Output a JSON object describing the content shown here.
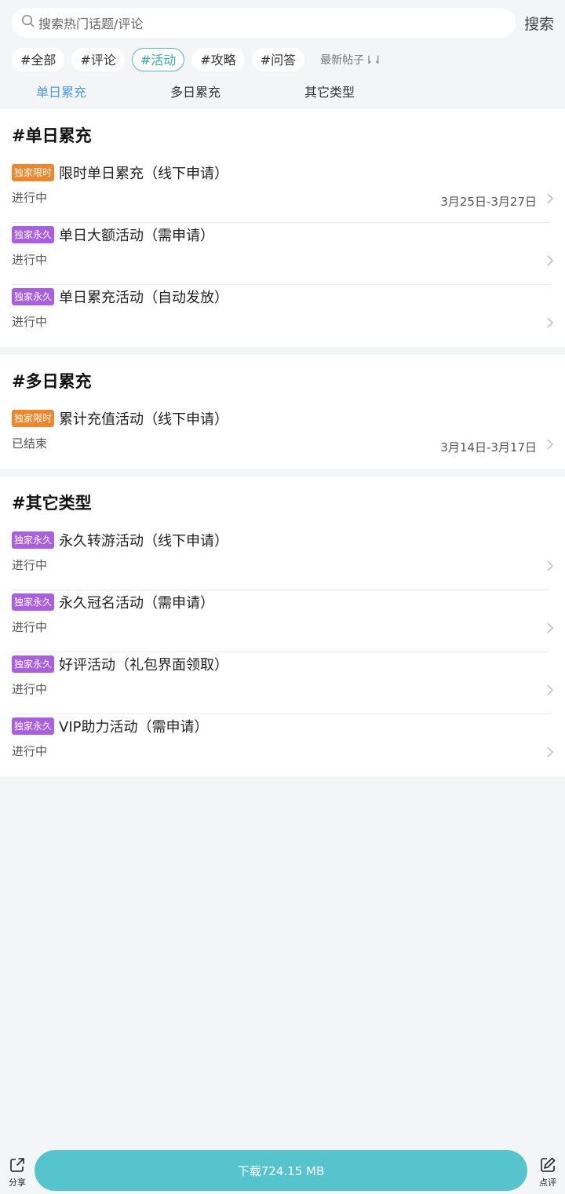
{
  "search": {
    "placeholder": "搜索热门话题/评论",
    "button": "搜索"
  },
  "tags": [
    {
      "label": "#全部",
      "active": false
    },
    {
      "label": "#评论",
      "active": false
    },
    {
      "label": "#活动",
      "active": true
    },
    {
      "label": "#攻略",
      "active": false
    },
    {
      "label": "#问答",
      "active": false
    }
  ],
  "sort_label": "最新帖子⇂⇃",
  "subtabs": [
    {
      "label": "单日累充",
      "active": true
    },
    {
      "label": "多日累充",
      "active": false
    },
    {
      "label": "其它类型",
      "active": false
    }
  ],
  "sections": [
    {
      "title": "#单日累充",
      "items": [
        {
          "badge": "独家限时",
          "badge_color": "#f0862b",
          "title": "限时单日累充（线下申请）",
          "status": "进行中",
          "date": "3月25日-3月27日"
        },
        {
          "badge": "独家永久",
          "badge_color": "#a95fe0",
          "title": "单日大额活动（需申请）",
          "status": "进行中",
          "date": ""
        },
        {
          "badge": "独家永久",
          "badge_color": "#a95fe0",
          "title": "单日累充活动（自动发放）",
          "status": "进行中",
          "date": ""
        }
      ]
    },
    {
      "title": "#多日累充",
      "items": [
        {
          "badge": "独家限时",
          "badge_color": "#f0862b",
          "title": "累计充值活动（线下申请）",
          "status": "已结束",
          "date": "3月14日-3月17日"
        }
      ]
    },
    {
      "title": "#其它类型",
      "items": [
        {
          "badge": "独家永久",
          "badge_color": "#a95fe0",
          "title": "永久转游活动（线下申请）",
          "status": "进行中",
          "date": ""
        },
        {
          "badge": "独家永久",
          "badge_color": "#a95fe0",
          "title": "永久冠名活动（需申请）",
          "status": "进行中",
          "date": ""
        },
        {
          "badge": "独家永久",
          "badge_color": "#a95fe0",
          "title": "好评活动（礼包界面领取）",
          "status": "进行中",
          "date": ""
        },
        {
          "badge": "独家永久",
          "badge_color": "#a95fe0",
          "title": "VIP助力活动（需申请）",
          "status": "进行中",
          "date": ""
        }
      ]
    }
  ],
  "bottom": {
    "share": "分享",
    "download": "下载724.15 MB",
    "review": "点评",
    "accent": "#55c4cc"
  }
}
